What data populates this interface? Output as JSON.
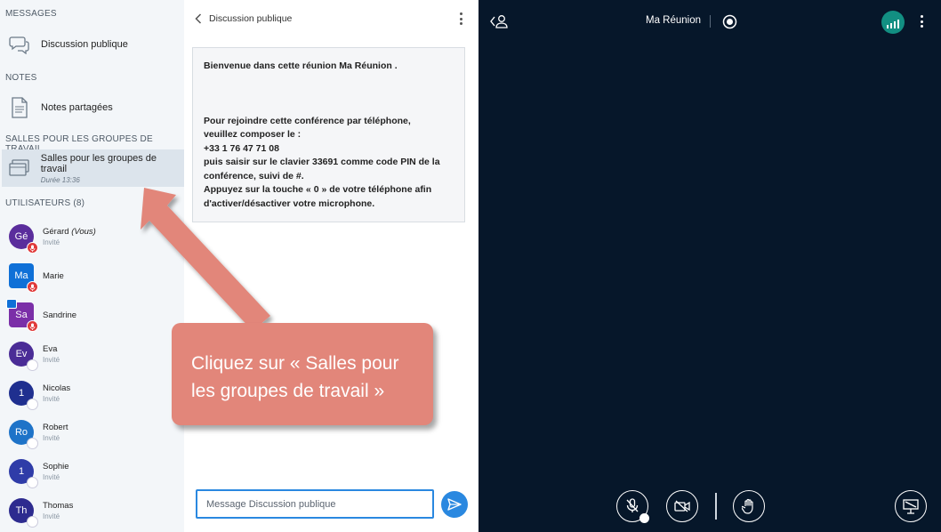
{
  "sidebar": {
    "messages_title": "MESSAGES",
    "public_chat": "Discussion publique",
    "notes_title": "NOTES",
    "shared_notes": "Notes partagées",
    "breakout_title": "SALLES POUR LES GROUPES DE TRAVAIL",
    "breakout_label": "Salles pour les groupes de travail",
    "breakout_duration": "Durée 13:36",
    "users_title": "UTILISATEURS (8)",
    "users": [
      {
        "initials": "Gé",
        "name": "Gérard",
        "you": "(Vous)",
        "role": "Invité",
        "color": "#5A2D9C"
      },
      {
        "initials": "Ma",
        "name": "Marie",
        "role": "",
        "color": "#0F70D7"
      },
      {
        "initials": "Sa",
        "name": "Sandrine",
        "role": "",
        "color": "#7B2FA8"
      },
      {
        "initials": "Ev",
        "name": "Eva",
        "role": "Invité",
        "color": "#4A2C96"
      },
      {
        "initials": "1",
        "name": "Nicolas",
        "role": "Invité",
        "color": "#1F2F8F"
      },
      {
        "initials": "Ro",
        "name": "Robert",
        "role": "Invité",
        "color": "#1E73C8"
      },
      {
        "initials": "1",
        "name": "Sophie",
        "role": "Invité",
        "color": "#2F3CA8"
      },
      {
        "initials": "Th",
        "name": "Thomas",
        "role": "Invité",
        "color": "#2D2B8F"
      }
    ]
  },
  "chat": {
    "title": "Discussion publique",
    "welcome_prefix": "Bienvenue dans cette réunion ",
    "welcome_meeting": "Ma Réunion",
    "welcome_suffix": " .",
    "dial_l1": "Pour rejoindre cette conférence par téléphone,",
    "dial_l2": "veuillez composer le :",
    "dial_l3": "+33 1 76 47 71 08",
    "dial_l4": "puis saisir sur le clavier 33691 comme code PIN de la",
    "dial_l5": "conférence, suivi de #.",
    "dial_l6": "Appuyez sur la touche « 0 » de votre téléphone afin",
    "dial_l7": "d'activer/désactiver votre microphone.",
    "input_placeholder": "Message Discussion publique"
  },
  "main": {
    "meeting_title": "Ma Réunion"
  },
  "callout": {
    "line1": "Cliquez sur « Salles pour",
    "line2": "les groupes de travail »"
  },
  "colors": {
    "accent": "#2A88E0",
    "dark_bg": "#06172A",
    "callout": "#E2867A",
    "connection": "#128F82",
    "muted_badge": "#E03A3A"
  }
}
